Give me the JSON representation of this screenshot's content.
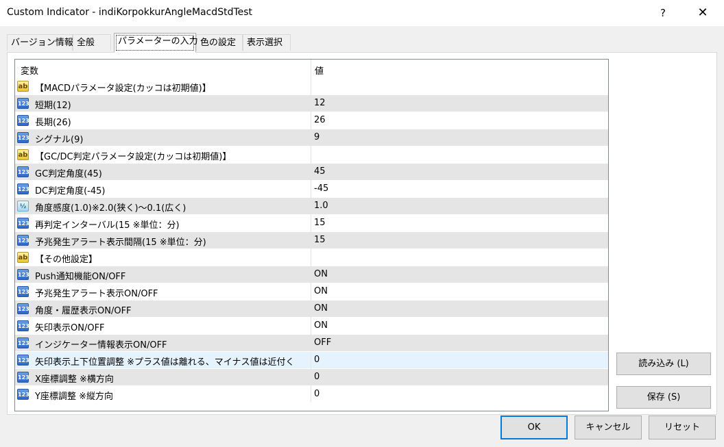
{
  "window": {
    "title": "Custom Indicator - indiKorpokkurAngleMacdStdTest",
    "help": "?",
    "close": "✕"
  },
  "tabs": [
    {
      "label": "バージョン情報"
    },
    {
      "label": "全般"
    },
    {
      "label": "パラメーターの入力"
    },
    {
      "label": "色の設定"
    },
    {
      "label": "表示選択"
    }
  ],
  "table": {
    "columns": {
      "name": "変数",
      "value": "値"
    },
    "rows": [
      {
        "type": "str",
        "icon": "ab",
        "name": "【MACDパラメータ設定(カッコは初期値)】",
        "value": ""
      },
      {
        "type": "int",
        "icon": "123",
        "name": "短期(12)",
        "value": "12"
      },
      {
        "type": "int",
        "icon": "123",
        "name": "長期(26)",
        "value": "26"
      },
      {
        "type": "int",
        "icon": "123",
        "name": "シグナル(9)",
        "value": "9"
      },
      {
        "type": "str",
        "icon": "ab",
        "name": "【GC/DC判定パラメータ設定(カッコは初期値)】",
        "value": ""
      },
      {
        "type": "int",
        "icon": "123",
        "name": "GC判定角度(45)",
        "value": "45"
      },
      {
        "type": "int",
        "icon": "123",
        "name": "DC判定角度(-45)",
        "value": "-45"
      },
      {
        "type": "dbl",
        "icon": "½",
        "name": "角度感度(1.0)※2.0(狭く)〜0.1(広く)",
        "value": "1.0"
      },
      {
        "type": "int",
        "icon": "123",
        "name": "再判定インターバル(15 ※単位：分)",
        "value": "15"
      },
      {
        "type": "int",
        "icon": "123",
        "name": "予兆発生アラート表示間隔(15 ※単位：分)",
        "value": "15"
      },
      {
        "type": "str",
        "icon": "ab",
        "name": "【その他設定】",
        "value": ""
      },
      {
        "type": "int",
        "icon": "123",
        "name": "Push通知機能ON/OFF",
        "value": "ON"
      },
      {
        "type": "int",
        "icon": "123",
        "name": "予兆発生アラート表示ON/OFF",
        "value": "ON"
      },
      {
        "type": "int",
        "icon": "123",
        "name": "角度・履歴表示ON/OFF",
        "value": "ON"
      },
      {
        "type": "int",
        "icon": "123",
        "name": "矢印表示ON/OFF",
        "value": "ON"
      },
      {
        "type": "int",
        "icon": "123",
        "name": "インジケーター情報表示ON/OFF",
        "value": "OFF"
      },
      {
        "type": "int",
        "icon": "123",
        "name": "矢印表示上下位置調整 ※プラス値は離れる、マイナス値は近付く",
        "value": "0",
        "selected": true
      },
      {
        "type": "int",
        "icon": "123",
        "name": "X座標調整 ※横方向",
        "value": "0"
      },
      {
        "type": "int",
        "icon": "123",
        "name": "Y座標調整 ※縦方向",
        "value": "0"
      }
    ]
  },
  "side_buttons": {
    "load": "読み込み (L)",
    "save": "保存 (S)"
  },
  "footer": {
    "ok": "OK",
    "cancel": "キャンセル",
    "reset": "リセット"
  }
}
